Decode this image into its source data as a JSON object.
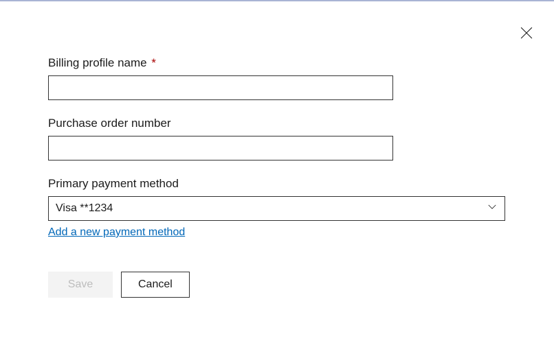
{
  "form": {
    "billing_profile_name": {
      "label": "Billing profile name",
      "required_marker": "*",
      "value": ""
    },
    "purchase_order_number": {
      "label": "Purchase order number",
      "value": ""
    },
    "primary_payment_method": {
      "label": "Primary payment method",
      "selected": "Visa **1234"
    },
    "add_payment_link": "Add a new payment method"
  },
  "buttons": {
    "save": "Save",
    "cancel": "Cancel"
  }
}
